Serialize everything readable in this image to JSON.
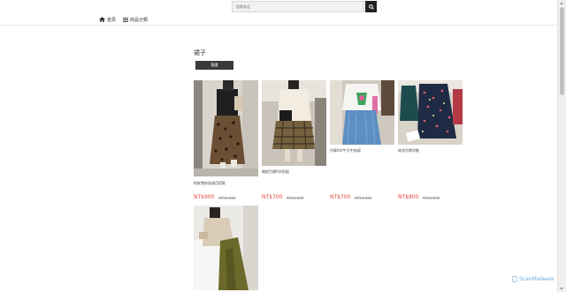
{
  "search": {
    "placeholder": "搜尋商品"
  },
  "nav": {
    "items": [
      {
        "label": "首頁"
      },
      {
        "label": "商品分類"
      }
    ]
  },
  "category": {
    "title": "裙子",
    "filter_label": "篩選"
  },
  "products": [
    {
      "name": "豹紋雪紡長裙百搭款",
      "price": "NT$900",
      "original_price": "NT$1,800"
    },
    {
      "name": "格紋百褶A字短裙",
      "price": "NT$700",
      "original_price": "NT$1,400"
    },
    {
      "name": "丹寧A字牛仔中長裙",
      "price": "NT$700",
      "original_price": "NT$1,400"
    },
    {
      "name": "碎花吊帶洋裝",
      "price": "NT$800",
      "original_price": "NT$1,600"
    },
    {
      "name": "",
      "price": "",
      "original_price": ""
    }
  ],
  "watermark": {
    "text": "ScanMalware"
  },
  "colors": {
    "price": "#e8463f",
    "button": "#3a3a3a",
    "search_button": "#222222"
  },
  "icons": {
    "search": "search-icon",
    "home": "home-icon",
    "menu": "menu-icon"
  }
}
